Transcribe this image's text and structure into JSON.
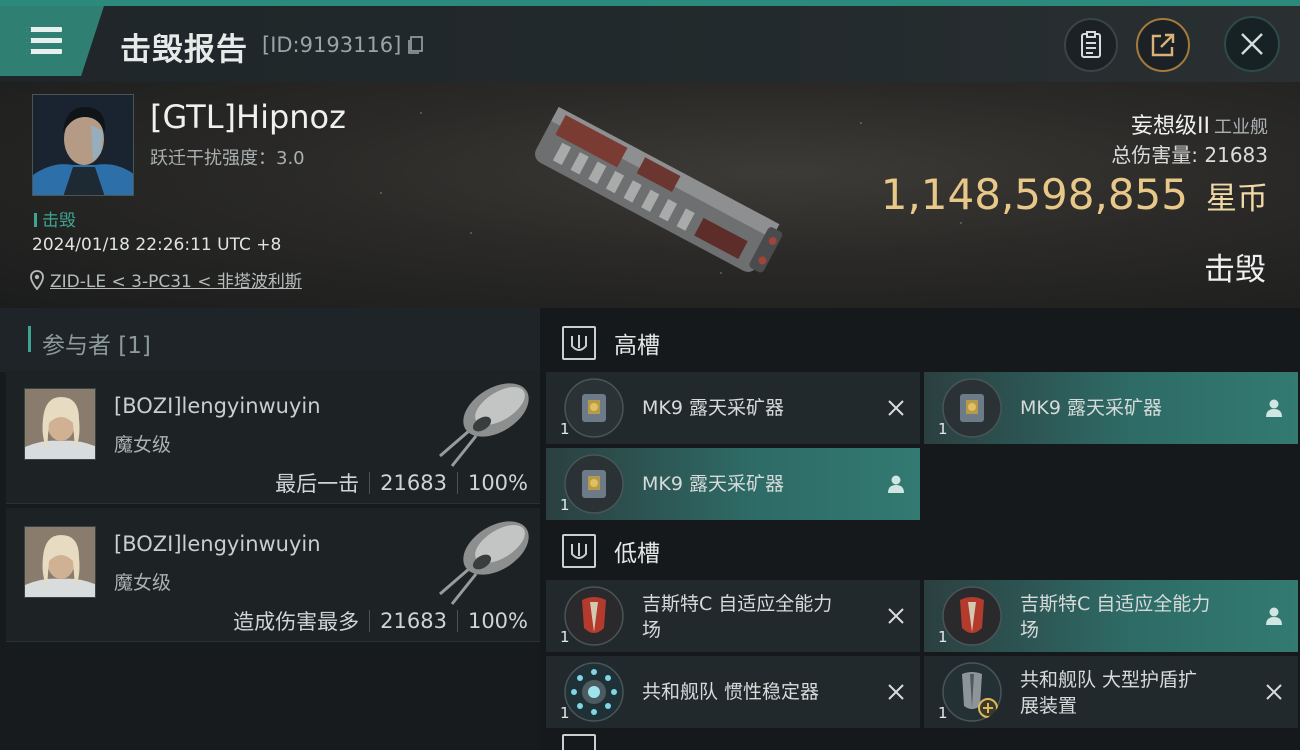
{
  "header": {
    "title": "击毁报告",
    "killmail_id": "[ID:9193116]",
    "copy_icon": "copy-icon",
    "buttons": [
      "clipboard-icon",
      "share-icon",
      "close-icon"
    ]
  },
  "victim": {
    "name": "[GTL]Hipnoz",
    "warp_disrupt": "跃迁干扰强度：3.0",
    "tag": "击毁",
    "datetime": "2024/01/18 22:26:11 UTC +8",
    "location": "ZID-LE < 3-PC31 < 非塔波利斯",
    "ship_name": "妄想级II",
    "ship_class": "工业舰",
    "total_damage": "总伤害量: 21683",
    "isk_value": "1,148,598,855",
    "isk_unit": "星币",
    "status": "击毁"
  },
  "participants": {
    "header": "参与者 [1]",
    "items": [
      {
        "name": "[BOZI]lengyinwuyin",
        "ship": "魔女级",
        "role": "最后一击",
        "damage": "21683",
        "percent": "100%"
      },
      {
        "name": "[BOZI]lengyinwuyin",
        "ship": "魔女级",
        "role": "造成伤害最多",
        "damage": "21683",
        "percent": "100%"
      }
    ]
  },
  "fitting": {
    "high_label": "高槽",
    "low_label": "低槽",
    "high": [
      {
        "qty": "1",
        "name": "MK9 露天采矿器",
        "state": "destroyed"
      },
      {
        "qty": "1",
        "name": "MK9 露天采矿器",
        "state": "dropped"
      },
      {
        "qty": "1",
        "name": "MK9 露天采矿器",
        "state": "dropped"
      }
    ],
    "low": [
      {
        "qty": "1",
        "name_line1": "吉斯特C 自适应全能力",
        "name_line2": "场",
        "state": "destroyed"
      },
      {
        "qty": "1",
        "name_line1": "吉斯特C 自适应全能力",
        "name_line2": "场",
        "state": "dropped"
      },
      {
        "qty": "1",
        "name_line1": "共和舰队 惯性稳定器",
        "name_line2": "",
        "state": "destroyed"
      },
      {
        "qty": "1",
        "name_line1": "共和舰队 大型护盾扩",
        "name_line2": "展装置",
        "state": "destroyed"
      }
    ]
  },
  "colors": {
    "accent": "#2c8a7c",
    "isk": "#e8c888",
    "dropped_row": "#327a72"
  }
}
